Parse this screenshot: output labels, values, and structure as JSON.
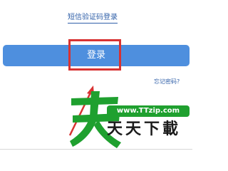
{
  "sms_login_link": "短信验证码登录",
  "login_button": {
    "label": "登录"
  },
  "forgot_password_link": "忘记密码?",
  "watermark": {
    "url": "www.TTzip.com",
    "name": "天天下載",
    "logo_text": "天"
  },
  "colors": {
    "button": "#4e8fde",
    "link": "#2f5fa8",
    "highlight": "#d83232",
    "watermark_green": "#1fa02f"
  }
}
